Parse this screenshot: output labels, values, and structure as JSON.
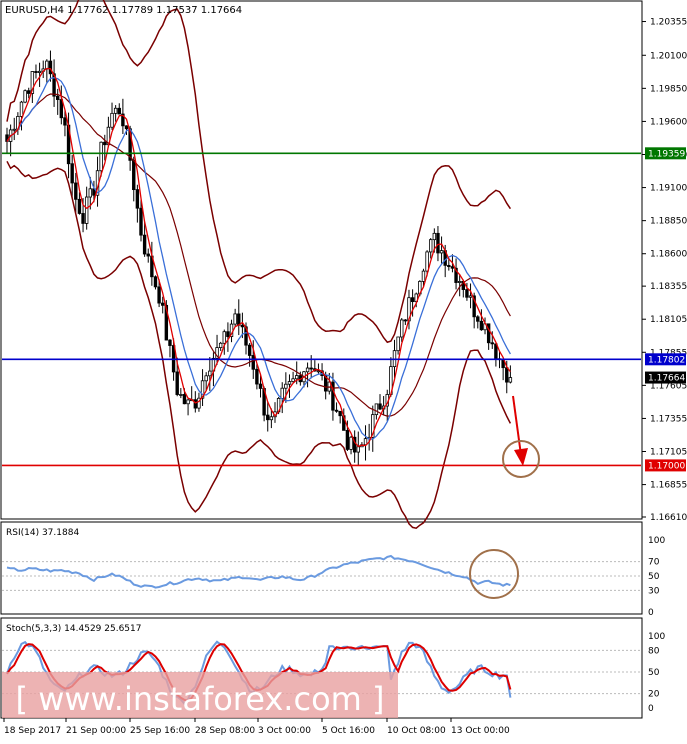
{
  "header": {
    "symbol_line": "EURUSD,H4  1.17762 1.17789 1.17537 1.17664"
  },
  "colors": {
    "candle": "#000000",
    "bb": "#7a0000",
    "ma_fast": "#e00000",
    "ma_slow": "#3a6fd8",
    "hline_green": "#007700",
    "hline_blue": "#0000cc",
    "hline_red": "#e00000",
    "rsi": "#6a9ae0",
    "stoch_main": "#6a9ae0",
    "stoch_signal": "#dd0000",
    "circle": "#a0704a",
    "arrow": "#e00000",
    "watermark_bg": "#e8a0a0"
  },
  "main_axis": {
    "ticks": [
      "1.20355",
      "1.20100",
      "1.19850",
      "1.19600",
      "1.19350",
      "1.19100",
      "1.18850",
      "1.18600",
      "1.18355",
      "1.18105",
      "1.17855",
      "1.17605",
      "1.17355",
      "1.17105",
      "1.16855",
      "1.16610"
    ]
  },
  "price_labels": {
    "green": "1.19359",
    "blue": "1.17802",
    "current": "1.17664",
    "red": "1.17000"
  },
  "rsi_panel": {
    "title": "RSI(14) 37.1884",
    "ticks": [
      "100",
      "70",
      "50",
      "30",
      "0"
    ]
  },
  "stoch_panel": {
    "title": "Stoch(5,3,3) 14.4529 25.6517",
    "ticks": [
      "100",
      "80",
      "50",
      "20",
      "0"
    ]
  },
  "time_axis": {
    "labels": [
      "18 Sep 2017",
      "21 Sep 00:00",
      "25 Sep 16:00",
      "28 Sep 08:00",
      "3 Oct 00:00",
      "5 Oct 16:00",
      "10 Oct 08:00",
      "13 Oct 00:00"
    ]
  },
  "watermark": "[ www.instaforex.com ]",
  "chart_data": {
    "type": "line",
    "symbol": "EURUSD",
    "timeframe": "H4",
    "ohlc_last": {
      "open": 1.17762,
      "high": 1.17789,
      "low": 1.17537,
      "close": 1.17664
    },
    "ylim": [
      1.1661,
      1.2048
    ],
    "horizontal_levels": [
      {
        "value": 1.19359,
        "color": "green"
      },
      {
        "value": 1.17802,
        "color": "blue"
      },
      {
        "value": 1.17,
        "color": "red"
      }
    ],
    "price_path": [
      1.1945,
      1.1965,
      1.1985,
      1.1995,
      1.2005,
      1.1985,
      1.196,
      1.1905,
      1.189,
      1.1905,
      1.194,
      1.1965,
      1.197,
      1.193,
      1.188,
      1.185,
      1.183,
      1.179,
      1.1755,
      1.1745,
      1.175,
      1.1775,
      1.1785,
      1.1795,
      1.1815,
      1.1795,
      1.1775,
      1.1745,
      1.173,
      1.1752,
      1.1762,
      1.1772,
      1.1778,
      1.1766,
      1.1755,
      1.1738,
      1.1715,
      1.1708,
      1.1725,
      1.1742,
      1.1758,
      1.179,
      1.1815,
      1.1835,
      1.1858,
      1.187,
      1.186,
      1.1848,
      1.1838,
      1.182,
      1.181,
      1.1795,
      1.1778,
      1.17664
    ],
    "rsi": {
      "value": 37.1884,
      "levels": [
        70,
        50,
        30
      ],
      "ylim": [
        0,
        100
      ],
      "path": [
        60,
        59,
        58,
        60,
        59,
        58,
        57,
        58,
        56,
        55,
        50,
        45,
        48,
        52,
        51,
        46,
        40,
        37,
        35,
        36,
        38,
        40,
        42,
        45,
        47,
        46,
        44,
        43,
        45,
        47,
        49,
        47,
        44,
        46,
        48,
        49,
        47,
        45,
        46,
        50,
        55,
        59,
        63,
        66,
        68,
        70,
        72,
        74,
        75,
        76,
        74,
        72,
        70,
        66,
        62,
        58,
        55,
        52,
        50,
        45,
        40,
        42,
        40,
        38,
        37
      ]
    },
    "stochastic": {
      "main": 14.4529,
      "signal": 25.6517,
      "levels": [
        80,
        50,
        20
      ],
      "ylim": [
        0,
        100
      ]
    }
  }
}
